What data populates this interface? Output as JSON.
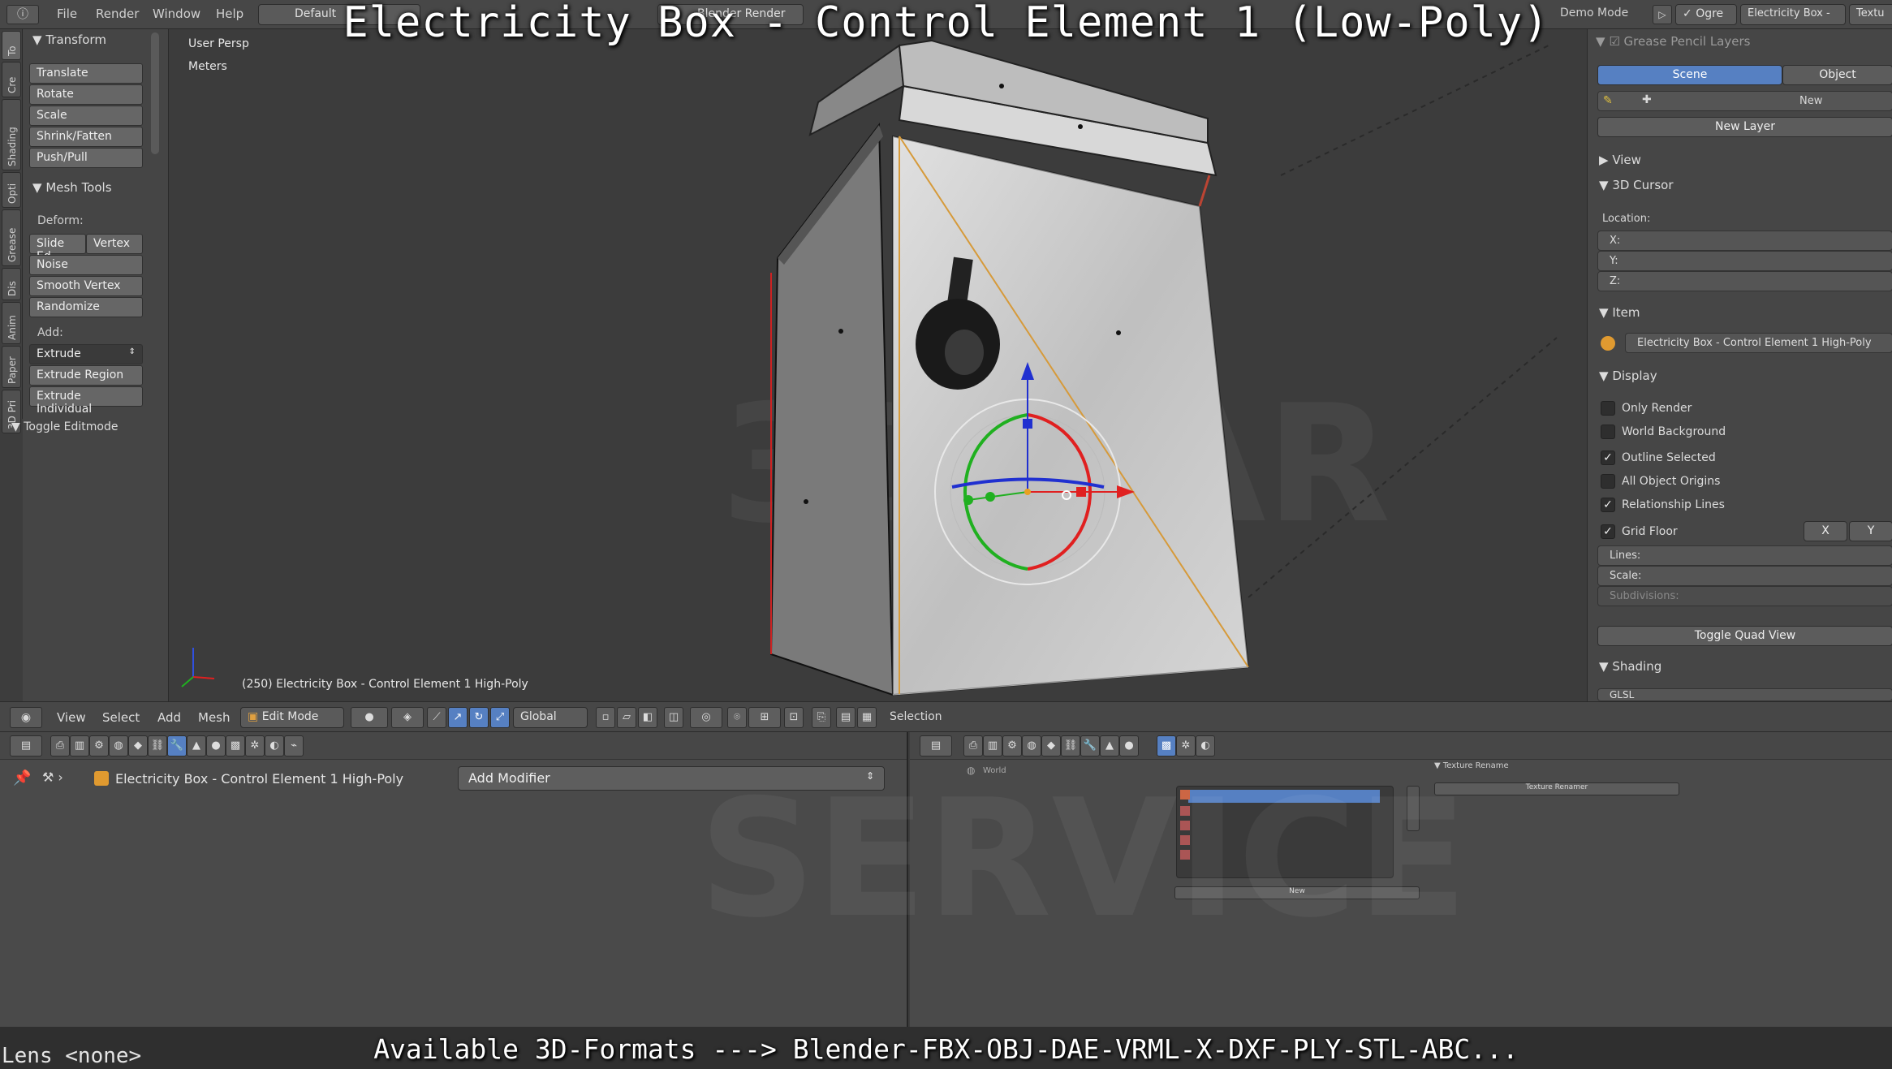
{
  "overlay": {
    "title": "Electricity Box  -  Control Element 1 (Low-Poly)",
    "bottom_caption": "Available 3D-Formats ---> Blender-FBX-OBJ-DAE-VRML-X-DXF-PLY-STL-ABC...",
    "lens": "Lens <none>"
  },
  "topbar": {
    "menus": [
      "File",
      "Render",
      "Window",
      "Help"
    ],
    "layout": "Default",
    "render_engine": "Blender Render",
    "demo_mode": "Demo Mode",
    "mode_labels": [
      "Ogre",
      "Electricity Box -",
      "Textu"
    ]
  },
  "toolshelf": {
    "tabs": [
      "To",
      "Cre",
      "Shading",
      "Opti",
      "Grease",
      "Dis",
      "Anim",
      "Paper",
      "3D Pri"
    ],
    "transform": {
      "header": "Transform",
      "buttons": [
        "Translate",
        "Rotate",
        "Scale",
        "Shrink/Fatten",
        "Push/Pull"
      ]
    },
    "mesh_tools": {
      "header": "Mesh Tools",
      "deform_label": "Deform:",
      "slide_edge": "Slide Ed",
      "vertex": "Vertex",
      "deform_buttons": [
        "Noise",
        "Smooth Vertex",
        "Randomize"
      ],
      "add_label": "Add:",
      "extrude": "Extrude",
      "add_buttons": [
        "Extrude Region",
        "Extrude Individual"
      ]
    },
    "toggle_editmode": "Toggle Editmode"
  },
  "viewport": {
    "view_name": "User Persp",
    "units": "Meters",
    "object_info": "(250) Electricity Box - Control Element 1 High-Poly",
    "watermark_1": "3DWAR",
    "watermark_2": "SERVICE"
  },
  "properties": {
    "grease_pencil": {
      "header": "Grease Pencil Layers",
      "tab_scene": "Scene",
      "tab_object": "Object",
      "new": "New",
      "new_layer": "New Layer"
    },
    "view_header": "View",
    "cursor": {
      "header": "3D Cursor",
      "location_label": "Location:",
      "fields": [
        "X:",
        "Y:",
        "Z:"
      ]
    },
    "item": {
      "header": "Item",
      "object_name": "Electricity Box - Control Element 1 High-Poly"
    },
    "display": {
      "header": "Display",
      "checkboxes": [
        {
          "label": "Only Render",
          "checked": false
        },
        {
          "label": "World Background",
          "checked": false
        },
        {
          "label": "Outline Selected",
          "checked": true
        },
        {
          "label": "All Object Origins",
          "checked": false
        },
        {
          "label": "Relationship Lines",
          "checked": true
        },
        {
          "label": "Grid Floor",
          "checked": true
        }
      ],
      "axis_x": "X",
      "axis_y": "Y",
      "grid_fields": [
        "Lines:",
        "Scale:",
        "Subdivisions:"
      ],
      "toggle_quad_view": "Toggle Quad View"
    },
    "shading": {
      "header": "Shading",
      "mode": "GLSL"
    }
  },
  "viewport_header": {
    "menus": [
      "View",
      "Select",
      "Add",
      "Mesh"
    ],
    "mode": "Edit Mode",
    "orientation": "Global",
    "status": "Selection"
  },
  "modifier_panel": {
    "object_name": "Electricity Box - Control Element 1 High-Poly",
    "add_modifier": "Add Modifier"
  },
  "texture_panel": {
    "world_label": "World",
    "texture_renamer_header": "Texture Rename",
    "texture_renamer_button": "Texture Renamer",
    "new": "New"
  },
  "colors": {
    "accent_blue": "#5680c2",
    "background": "#3c3c3c",
    "gizmo_red": "#e02020",
    "gizmo_green": "#20b020",
    "gizmo_blue": "#2030d0"
  }
}
